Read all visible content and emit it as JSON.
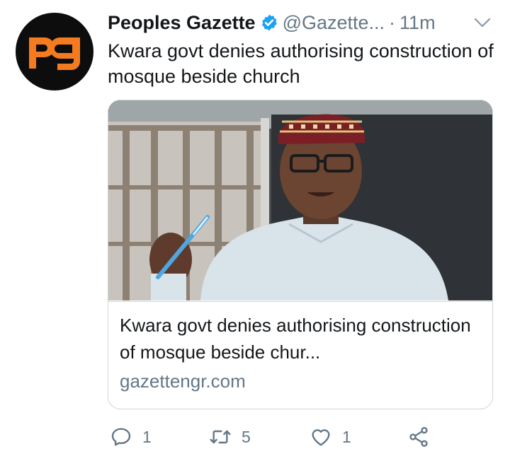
{
  "tweet": {
    "display_name": "Peoples Gazette",
    "handle": "@Gazette...",
    "separator": "·",
    "time": "11m",
    "text": "Kwara govt denies authorising construction of mosque beside church",
    "avatar_icon": "pg-logo-icon",
    "verified_icon": "verified-badge-icon"
  },
  "card": {
    "title": "Kwara govt denies authorising construction of mosque beside chur...",
    "domain": "gazettengr.com"
  },
  "actions": {
    "reply_count": "1",
    "retweet_count": "5",
    "like_count": "1"
  },
  "colors": {
    "accent": "#1da1f2",
    "text": "#14171a",
    "secondary": "#657786",
    "logo": "#f47b20"
  }
}
